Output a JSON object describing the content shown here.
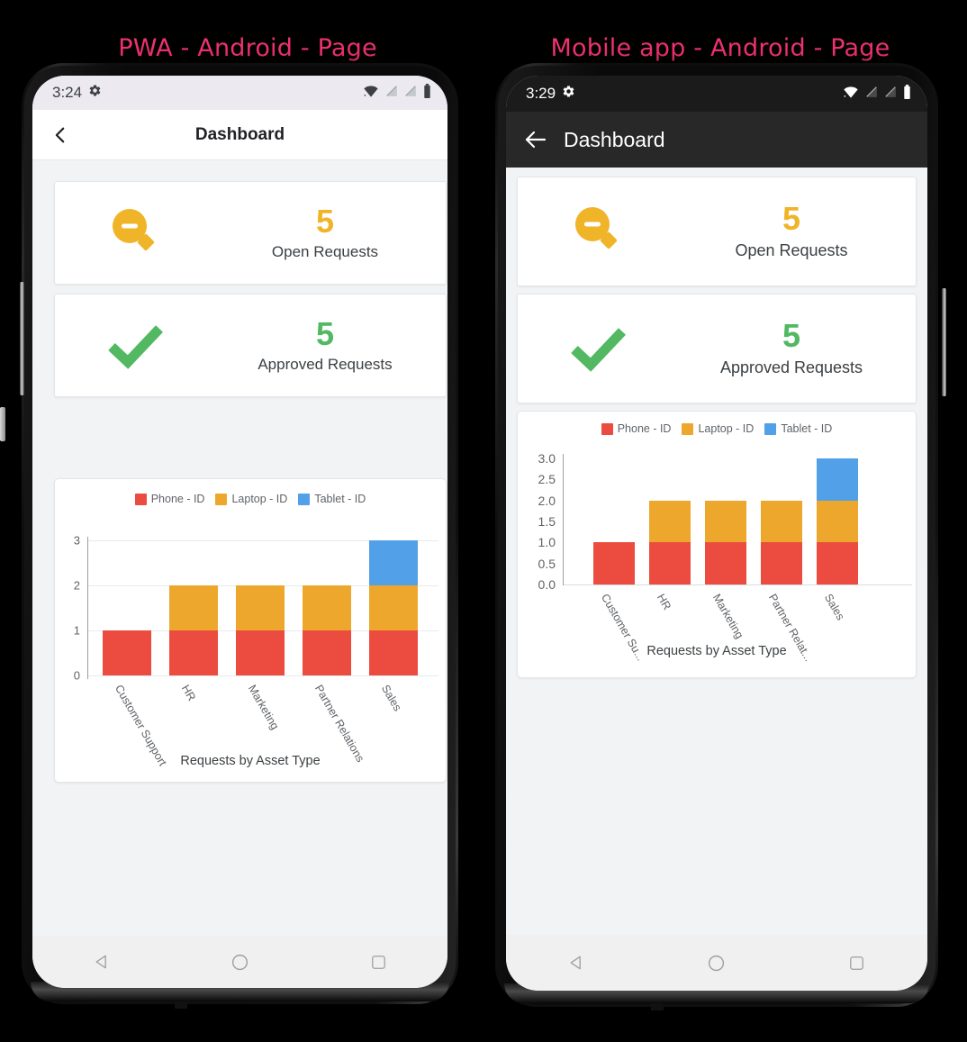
{
  "captions": {
    "left": "PWA - Android - Page",
    "right": "Mobile app - Android - Page"
  },
  "colors": {
    "caption": "#f0326e",
    "phone_red": "#ea4335",
    "bar_red": "#ec4c3f",
    "bar_orange": "#eda72c",
    "bar_blue": "#52a0e8",
    "stat_yellow": "#f0b429",
    "stat_green": "#52b862",
    "screen_bg": "#f1f3f4",
    "card_bg": "#ffffff",
    "appbar_dark": "#282828",
    "statusbar_light": "#eceaf0",
    "statusbar_dark": "#1b1b1b"
  },
  "left_phone": {
    "status": {
      "time": "3:24",
      "gear_icon": "gear-icon",
      "wifi_icon": "wifi-icon",
      "signal_icon_1": "no-signal-icon",
      "signal_icon_2": "no-signal-icon",
      "battery_icon": "battery-icon"
    },
    "appbar": {
      "back_icon": "chevron-left-icon",
      "title": "Dashboard"
    },
    "cards": [
      {
        "icon": "magnifier-minus-icon",
        "value": "5",
        "label": "Open Requests",
        "color": "#f0b429"
      },
      {
        "icon": "checkmark-icon",
        "value": "5",
        "label": "Approved Requests",
        "color": "#52b862"
      }
    ],
    "chart_title": "Requests by Asset Type",
    "nav": {
      "back_icon": "triangle-back-icon",
      "home_icon": "circle-home-icon",
      "recents_icon": "square-recents-icon"
    }
  },
  "right_phone": {
    "status": {
      "time": "3:29",
      "gear_icon": "gear-icon",
      "wifi_icon": "wifi-icon",
      "signal_icon_1": "no-signal-icon",
      "signal_icon_2": "no-signal-icon",
      "battery_icon": "battery-icon"
    },
    "appbar": {
      "back_icon": "arrow-left-icon",
      "title": "Dashboard"
    },
    "cards": [
      {
        "icon": "magnifier-minus-icon",
        "value": "5",
        "label": "Open Requests",
        "color": "#f0b429"
      },
      {
        "icon": "checkmark-icon",
        "value": "5",
        "label": "Approved Requests",
        "color": "#52b862"
      }
    ],
    "chart_title": "Requests by Asset Type",
    "nav": {
      "back_icon": "triangle-back-icon",
      "home_icon": "circle-home-icon",
      "recents_icon": "square-recents-icon"
    }
  },
  "chart_data": [
    {
      "id": "left",
      "type": "bar",
      "stacked": true,
      "title": "Requests by Asset Type",
      "xlabel": "",
      "ylabel": "",
      "categories": [
        "Customer Support",
        "HR",
        "Marketing",
        "Partner Relations",
        "Sales"
      ],
      "series": [
        {
          "name": "Phone - ID",
          "color": "#ec4c3f",
          "values": [
            1,
            1,
            1,
            1,
            1
          ]
        },
        {
          "name": "Laptop - ID",
          "color": "#eda72c",
          "values": [
            0,
            1,
            1,
            1,
            1
          ]
        },
        {
          "name": "Tablet - ID",
          "color": "#52a0e8",
          "values": [
            0,
            0,
            0,
            0,
            1
          ]
        }
      ],
      "ylim": [
        0,
        3
      ],
      "yticks": [
        "0",
        "1",
        "2",
        "3"
      ],
      "ytick_values": [
        0,
        1,
        2,
        3
      ],
      "grid": true,
      "legend_position": "top"
    },
    {
      "id": "right",
      "type": "bar",
      "stacked": true,
      "title": "Requests by Asset Type",
      "xlabel": "",
      "ylabel": "",
      "categories": [
        "Customer Su...",
        "HR",
        "Marketing",
        "Partner Relat...",
        "Sales"
      ],
      "series": [
        {
          "name": "Phone - ID",
          "color": "#ec4c3f",
          "values": [
            1,
            1,
            1,
            1,
            1
          ]
        },
        {
          "name": "Laptop - ID",
          "color": "#eda72c",
          "values": [
            0,
            1,
            1,
            1,
            1
          ]
        },
        {
          "name": "Tablet - ID",
          "color": "#52a0e8",
          "values": [
            0,
            0,
            0,
            0,
            1
          ]
        }
      ],
      "ylim": [
        0,
        3
      ],
      "yticks": [
        "0.0",
        "0.5",
        "1.0",
        "1.5",
        "2.0",
        "2.5",
        "3.0"
      ],
      "ytick_values": [
        0,
        0.5,
        1,
        1.5,
        2,
        2.5,
        3
      ],
      "grid": false,
      "legend_position": "top"
    }
  ]
}
